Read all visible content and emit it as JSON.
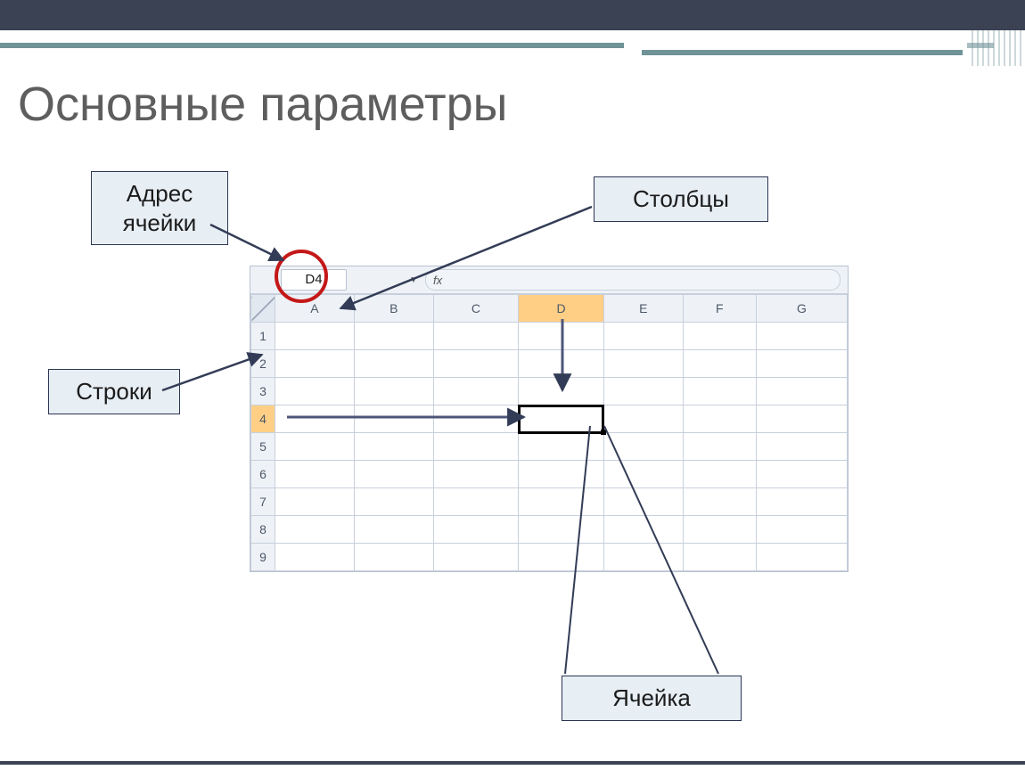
{
  "title": "Основные параметры",
  "labels": {
    "address": "Адрес ячейки",
    "rows": "Строки",
    "columns": "Столбцы",
    "cell": "Ячейка"
  },
  "excel": {
    "name_box": "D4",
    "fx_label": "fx",
    "columns": [
      "A",
      "B",
      "C",
      "D",
      "E",
      "F",
      "G"
    ],
    "rows": [
      "1",
      "2",
      "3",
      "4",
      "5",
      "6",
      "7",
      "8",
      "9"
    ],
    "highlighted_column": "D",
    "highlighted_row": "4",
    "selected_cell": "D4"
  }
}
